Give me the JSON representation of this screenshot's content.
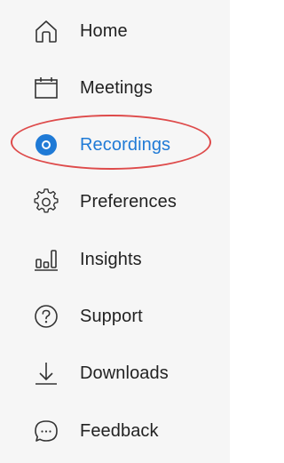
{
  "sidebar": {
    "accent_color": "#1f7ad6",
    "highlight_color": "#de4b4b",
    "items": [
      {
        "label": "Home",
        "icon": "home-icon",
        "active": false
      },
      {
        "label": "Meetings",
        "icon": "calendar-icon",
        "active": false
      },
      {
        "label": "Recordings",
        "icon": "record-icon",
        "active": true
      },
      {
        "label": "Preferences",
        "icon": "gear-icon",
        "active": false
      },
      {
        "label": "Insights",
        "icon": "bar-chart-icon",
        "active": false
      },
      {
        "label": "Support",
        "icon": "help-icon",
        "active": false
      },
      {
        "label": "Downloads",
        "icon": "download-icon",
        "active": false
      },
      {
        "label": "Feedback",
        "icon": "chat-bubble-icon",
        "active": false
      }
    ]
  }
}
